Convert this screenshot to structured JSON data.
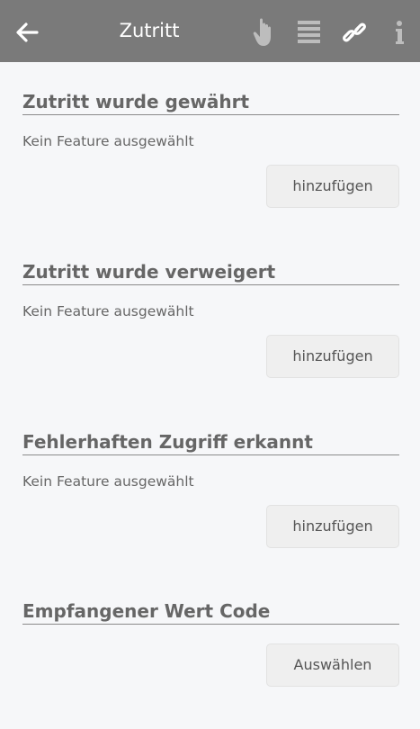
{
  "header": {
    "title": "Zutritt",
    "icons": [
      "back-arrow-icon",
      "hand-pointer-icon",
      "list-icon",
      "link-icon",
      "info-icon"
    ]
  },
  "sections": [
    {
      "heading": "Zutritt wurde gewährt",
      "status": "Kein Feature ausgewählt",
      "button": "hinzufügen"
    },
    {
      "heading": "Zutritt wurde verweigert",
      "status": "Kein Feature ausgewählt",
      "button": "hinzufügen"
    },
    {
      "heading": "Fehlerhaften Zugriff erkannt",
      "status": "Kein Feature ausgewählt",
      "button": "hinzufügen"
    },
    {
      "heading": "Empfangener Wert Code",
      "button": "Auswählen"
    }
  ],
  "colors": {
    "header_bg": "#7a7a7a",
    "page_bg": "#f6f7f9",
    "button_bg": "#efefef",
    "icon_active": "#ffffff",
    "icon_dim": "#bdbdbd"
  }
}
